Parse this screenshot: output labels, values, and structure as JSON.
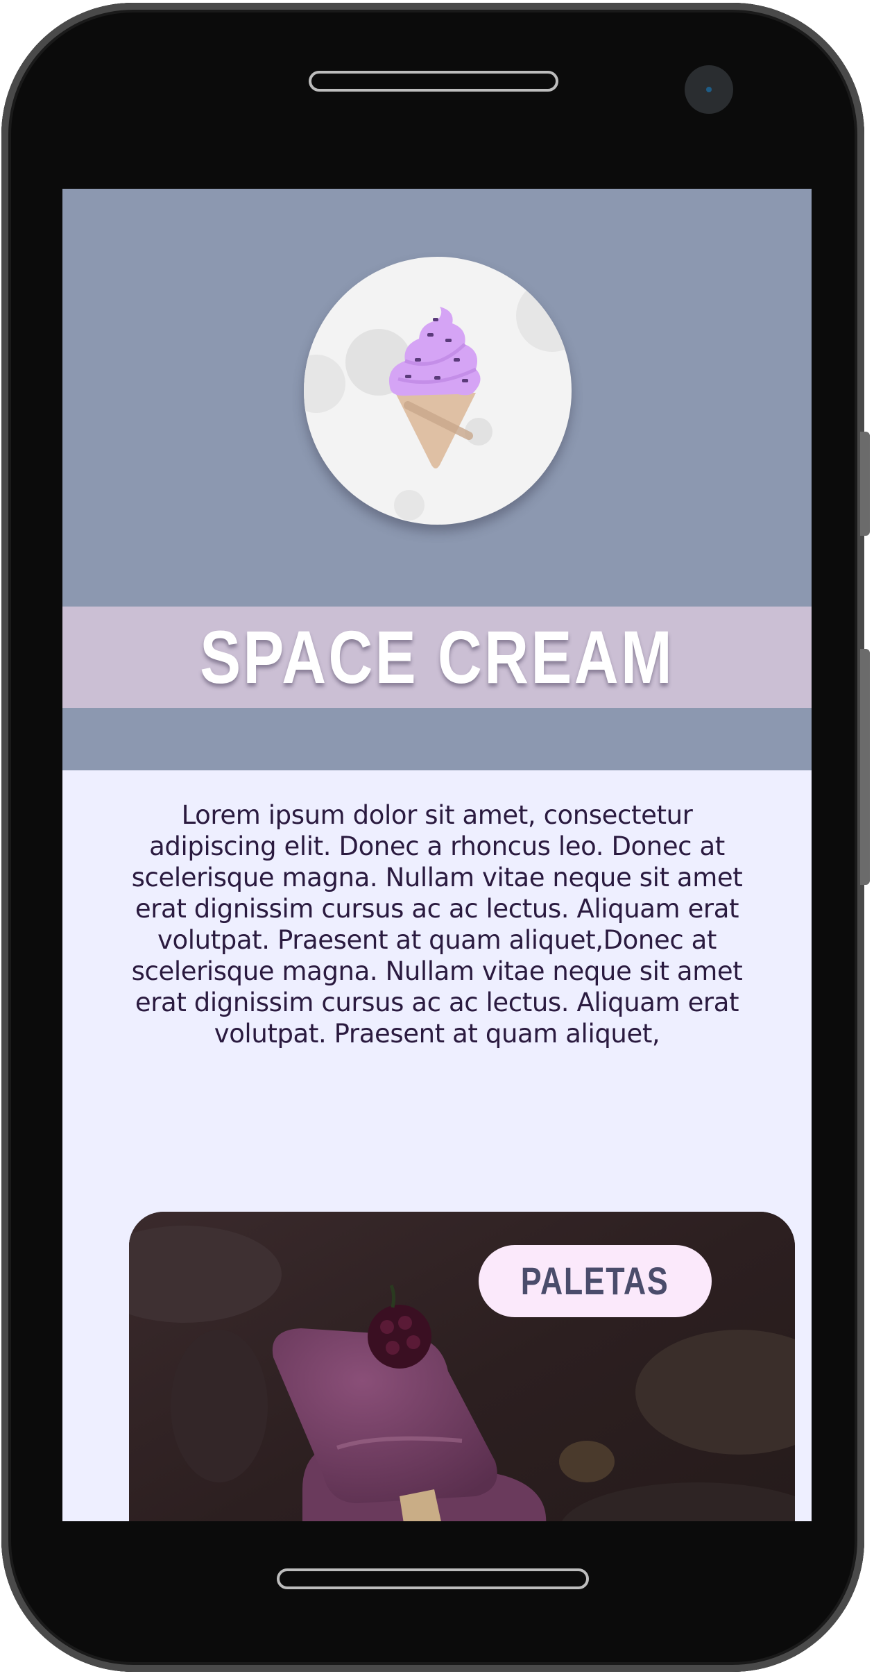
{
  "app": {
    "title": "SPACE CREAM",
    "description": "Lorem ipsum dolor sit amet, consectetur adipiscing elit. Donec a rhoncus leo. Donec at scelerisque magna. Nullam vitae neque sit amet erat dignissim cursus ac ac lectus. Aliquam erat volutpat. Praesent at quam aliquet,Donec at scelerisque magna. Nullam vitae neque sit amet erat dignissim cursus ac ac lectus. Aliquam erat volutpat. Praesent at quam aliquet,"
  },
  "logo": {
    "icon": "ice-cream-cone-icon"
  },
  "category_card": {
    "label": "PALETAS",
    "image": "purple-popsicle-with-blackberry"
  },
  "colors": {
    "hero_background": "#8c98b0",
    "title_band": "#cbbfd4",
    "page_background": "#eeefff",
    "text": "#2a1a3f",
    "pill_background": "#fbe9fb",
    "pill_text": "#4a4c6b",
    "ice_cream": "#d5a4f5",
    "cone": "#dfc0a4"
  }
}
